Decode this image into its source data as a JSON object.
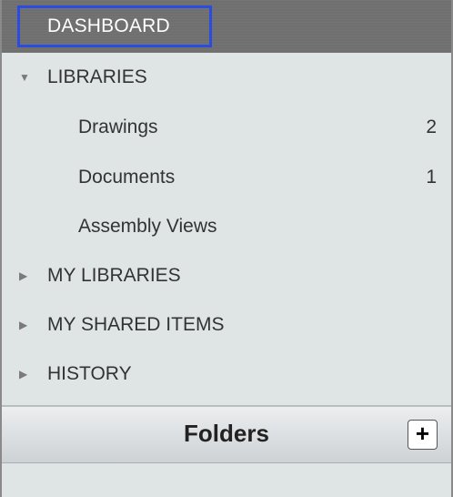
{
  "header": {
    "dashboard_label": "DASHBOARD"
  },
  "tree": {
    "libraries": {
      "label": "LIBRARIES",
      "expanded": true,
      "children": [
        {
          "label": "Drawings",
          "count": "2"
        },
        {
          "label": "Documents",
          "count": "1"
        },
        {
          "label": "Assembly Views",
          "count": ""
        }
      ]
    },
    "my_libraries": {
      "label": "MY LIBRARIES",
      "expanded": false
    },
    "my_shared_items": {
      "label": "MY SHARED ITEMS",
      "expanded": false
    },
    "history": {
      "label": "HISTORY",
      "expanded": false
    }
  },
  "folders": {
    "title": "Folders",
    "add_icon": "plus-icon"
  },
  "icons": {
    "expanded": "▼",
    "collapsed": "▶",
    "add": "+"
  },
  "colors": {
    "selection_border": "#2a4de0",
    "header_bg": "#6f6f6f",
    "panel_bg": "#dfe4e5"
  }
}
